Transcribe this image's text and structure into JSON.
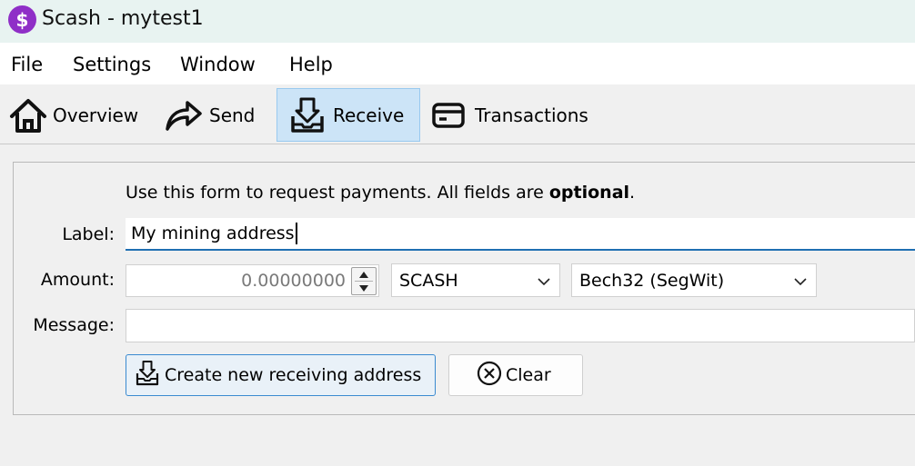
{
  "window": {
    "app_icon_glyph": "$",
    "app_icon_color": "#8f2fc7",
    "title": "Scash - mytest1"
  },
  "menu": {
    "items": [
      {
        "label": "File"
      },
      {
        "label": "Settings"
      },
      {
        "label": "Window"
      },
      {
        "label": "Help"
      }
    ]
  },
  "toolbar": {
    "tabs": [
      {
        "label": "Overview",
        "icon": "home-icon"
      },
      {
        "label": "Send",
        "icon": "send-arrow-icon"
      },
      {
        "label": "Receive",
        "icon": "receive-tray-icon",
        "active": true
      },
      {
        "label": "Transactions",
        "icon": "card-icon"
      }
    ],
    "active_color": "#cce4f7"
  },
  "form": {
    "intro_prefix": "Use this form to request payments. All fields are ",
    "intro_bold": "optional",
    "intro_suffix": ".",
    "label_label": "Label:",
    "label_value": "My mining address",
    "amount_label": "Amount:",
    "amount_value": "0.00000000",
    "unit_value": "SCASH",
    "address_type_value": "Bech32 (SegWit)",
    "message_label": "Message:",
    "message_value": "",
    "create_button": "Create new receiving address",
    "clear_button": "Clear"
  },
  "colors": {
    "focus_underline": "#1f6fb2",
    "primary_border": "#3a8ad0"
  }
}
